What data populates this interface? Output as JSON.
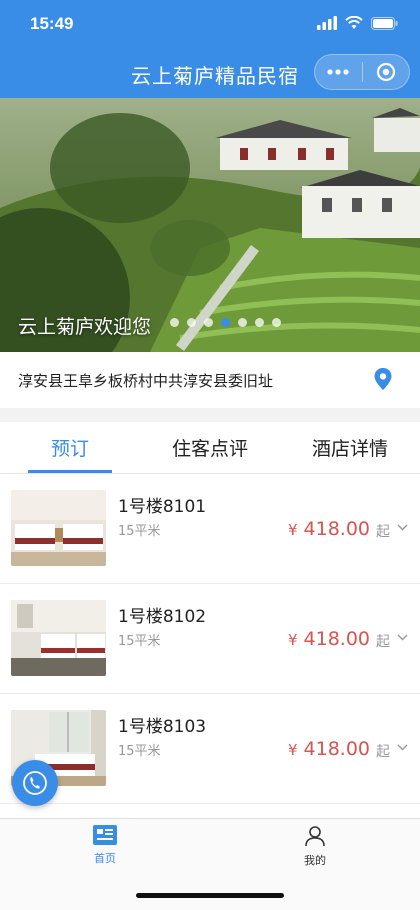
{
  "status_bar": {
    "time": "15:49"
  },
  "nav": {
    "title": "云上菊庐精品民宿",
    "more_icon": "more-dots-icon",
    "close_icon": "target-circle-icon"
  },
  "banner": {
    "caption": "云上菊庐欢迎您",
    "dot_count": 7,
    "active_dot": 4
  },
  "address": {
    "text": "淳安县王阜乡板桥村中共淳安县委旧址",
    "icon": "location-pin-icon"
  },
  "tabs": [
    {
      "label": "预订",
      "active": true
    },
    {
      "label": "住客点评",
      "active": false
    },
    {
      "label": "酒店详情",
      "active": false
    }
  ],
  "rooms": [
    {
      "name": "1号楼8101",
      "area": "15平米",
      "currency": "¥",
      "price": "418.00",
      "suffix": "起"
    },
    {
      "name": "1号楼8102",
      "area": "15平米",
      "currency": "¥",
      "price": "418.00",
      "suffix": "起"
    },
    {
      "name": "1号楼8103",
      "area": "15平米",
      "currency": "¥",
      "price": "418.00",
      "suffix": "起"
    }
  ],
  "tabbar": [
    {
      "label": "首页",
      "icon": "home-card-icon",
      "active": true
    },
    {
      "label": "我的",
      "icon": "user-icon",
      "active": false
    }
  ],
  "colors": {
    "primary": "#3a8de6",
    "price": "#d9534f"
  }
}
